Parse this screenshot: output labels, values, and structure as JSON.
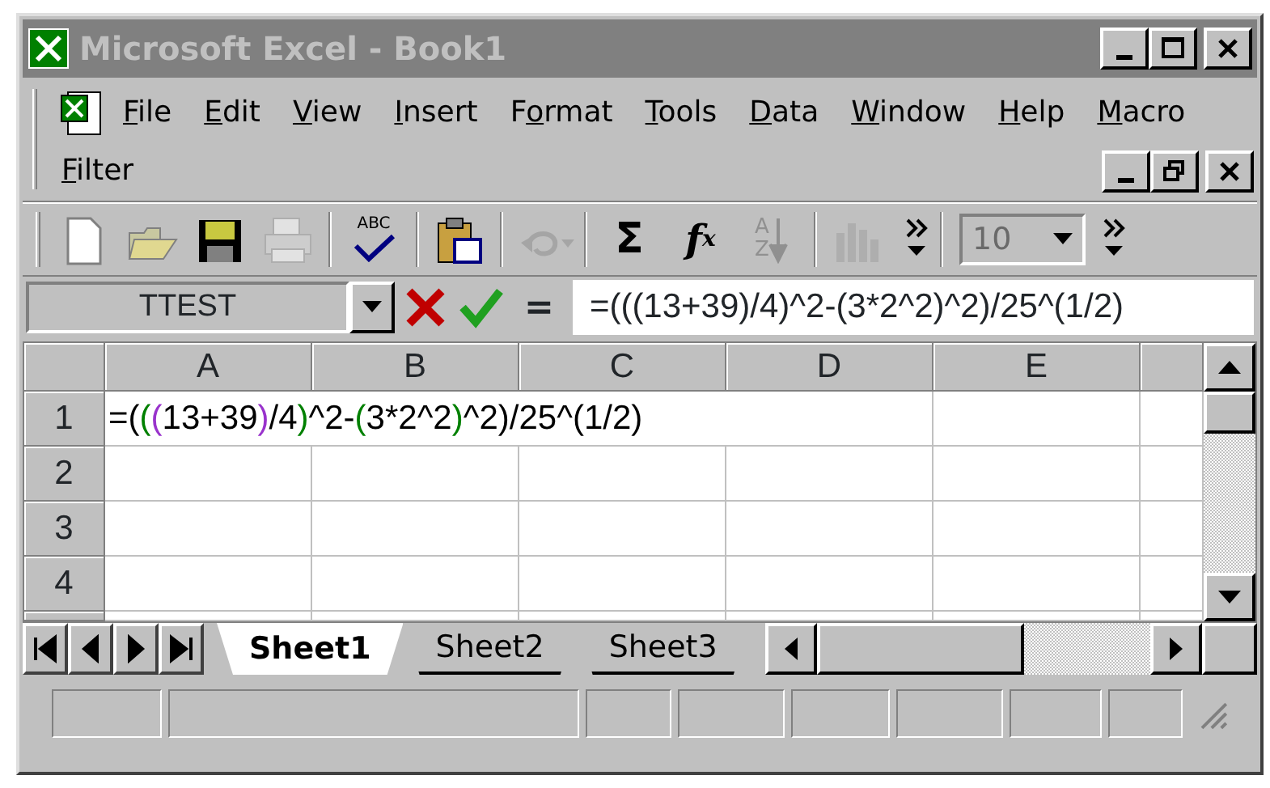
{
  "window": {
    "title": "Microsoft Excel - Book1"
  },
  "menu": [
    {
      "key": "F",
      "after": "ile"
    },
    {
      "key": "E",
      "after": "dit"
    },
    {
      "key": "V",
      "after": "iew"
    },
    {
      "key": "I",
      "after": "nsert"
    },
    {
      "before": "F",
      "key": "o",
      "after": "rmat"
    },
    {
      "key": "T",
      "after": "ools"
    },
    {
      "key": "D",
      "after": "ata"
    },
    {
      "key": "W",
      "after": "indow"
    },
    {
      "key": "H",
      "after": "elp"
    },
    {
      "key": "M",
      "after": "acro"
    },
    {
      "key": "F",
      "after": "ilter"
    }
  ],
  "toolbar": [
    {
      "kind": "new",
      "disabled": false
    },
    {
      "kind": "open",
      "disabled": false
    },
    {
      "kind": "save",
      "disabled": false
    },
    {
      "kind": "print",
      "disabled": true
    },
    {
      "kind": "separator"
    },
    {
      "kind": "spelling",
      "label": "ABC",
      "disabled": false
    },
    {
      "kind": "separator"
    },
    {
      "kind": "paste",
      "disabled": false
    },
    {
      "kind": "separator"
    },
    {
      "kind": "undo",
      "disabled": true
    },
    {
      "kind": "separator"
    },
    {
      "kind": "glyph",
      "label": "Σ",
      "disabled": false
    },
    {
      "kind": "function",
      "label": "f",
      "sub": "x",
      "disabled": false
    },
    {
      "kind": "sort",
      "letters": [
        "A",
        "Z"
      ],
      "disabled": true
    },
    {
      "kind": "separator"
    },
    {
      "kind": "chart",
      "disabled": true
    },
    {
      "kind": "more"
    }
  ],
  "font_size": {
    "value": "10",
    "disabled": true
  },
  "name_box": "TTEST",
  "formula_bar": {
    "equals": "=",
    "value": "=(((13+39)/4)^2-(3*2^2)^2)/25^(1/2)"
  },
  "columns": [
    "A",
    "B",
    "C",
    "D",
    "E"
  ],
  "rows": [
    {
      "header": "1",
      "cells": [
        {
          "segments": [
            {
              "text": "=(",
              "color": "#000000"
            },
            {
              "text": "(",
              "color": "#008000"
            },
            {
              "text": "(",
              "color": "#9933cc"
            },
            {
              "text": "13+39",
              "color": "#000000"
            },
            {
              "text": ")",
              "color": "#9933cc"
            },
            {
              "text": "/4",
              "color": "#000000"
            },
            {
              "text": ")",
              "color": "#008000"
            },
            {
              "text": "^2-",
              "color": "#000000"
            },
            {
              "text": "(",
              "color": "#008000"
            },
            {
              "text": "3*2^2",
              "color": "#000000"
            },
            {
              "text": ")",
              "color": "#008000"
            },
            {
              "text": "^2)/25^(1/2)",
              "color": "#000000"
            }
          ]
        }
      ]
    },
    {
      "header": "2"
    },
    {
      "header": "3"
    },
    {
      "header": "4"
    }
  ],
  "sheet_tabs": [
    {
      "label": "Sheet1",
      "selected": true
    },
    {
      "label": "Sheet2",
      "selected": false
    },
    {
      "label": "Sheet3",
      "selected": false
    }
  ]
}
